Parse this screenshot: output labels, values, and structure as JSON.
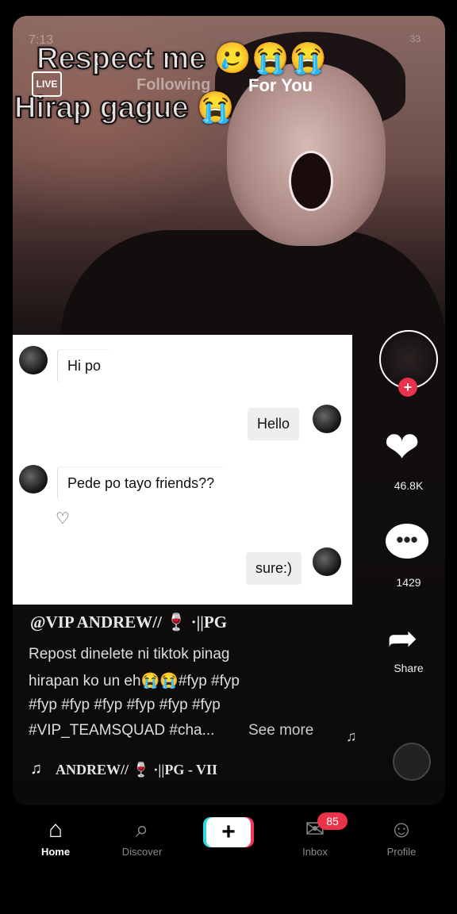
{
  "status": {
    "time": "7:13",
    "right": "33"
  },
  "overlay": {
    "line1": "Respect me",
    "line1_emojis": "🥲😭😭",
    "line2": "Hirap gague",
    "line2_emoji": "😭"
  },
  "header": {
    "live_label": "LIVE",
    "tab_following": "Following",
    "tab_for_you": "For You"
  },
  "chat": {
    "messages": [
      {
        "side": "in",
        "text": "Hi po"
      },
      {
        "side": "out",
        "text": "Hello"
      },
      {
        "side": "in",
        "text": "Pede po tayo friends??"
      },
      {
        "side": "out",
        "text": "sure:)"
      }
    ]
  },
  "rail": {
    "like_count": "46.8K",
    "comment_count": "1429",
    "share_label": "Share"
  },
  "post": {
    "username": "@VIP ANDREW// 🍷 ·||PG",
    "caption_lines": [
      "Repost dinelete ni tiktok pinag",
      "hirapan ko un eh😭😭#fyp #fyp",
      "#fyp #fyp #fyp #fyp #fyp #fyp",
      "#VIP_TEAMSQUAD #cha..."
    ],
    "see_more": "See more",
    "music_text": "ANDREW// 🍷 ·||PG - VII"
  },
  "nav": {
    "home": "Home",
    "discover": "Discover",
    "inbox": "Inbox",
    "inbox_badge": "85",
    "profile": "Profile"
  },
  "colors": {
    "accent_red": "#e8334a",
    "accent_cyan": "#2ed6e0"
  }
}
